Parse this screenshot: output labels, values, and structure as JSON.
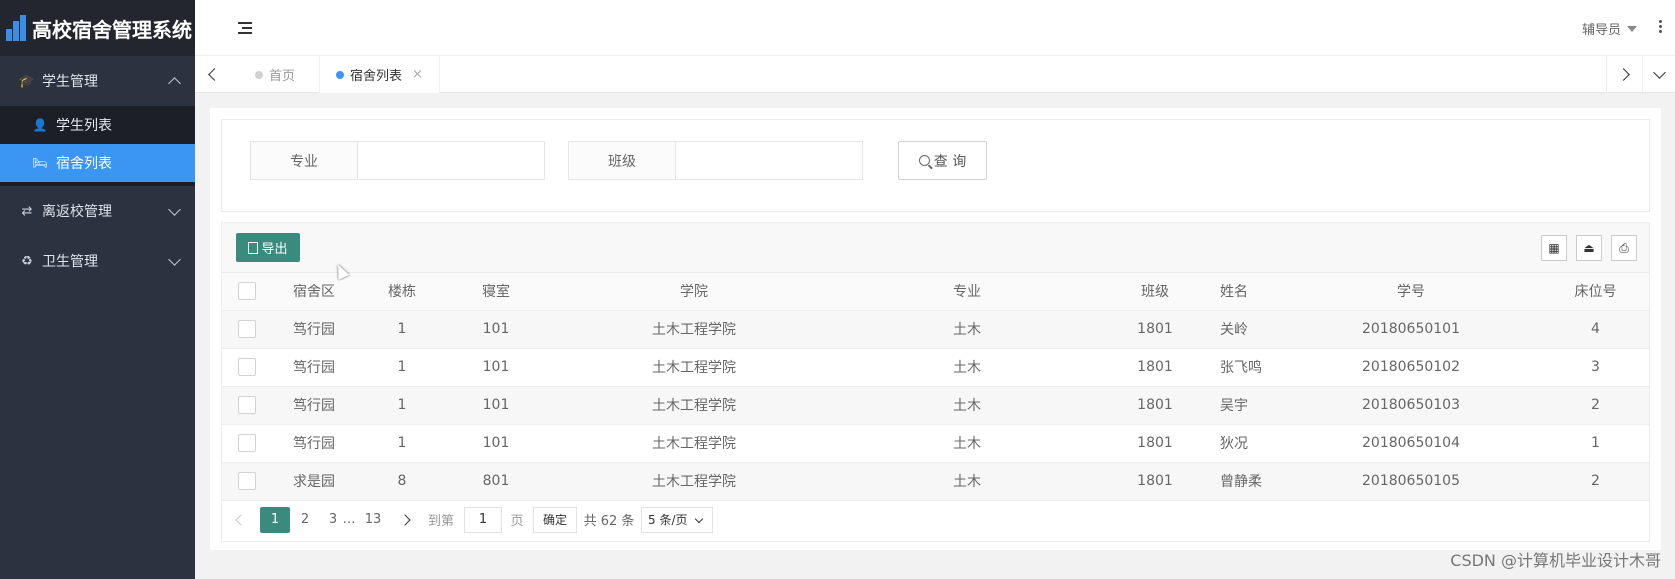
{
  "app": {
    "title": "高校宿舍管理系统"
  },
  "sidebar": {
    "groups": [
      {
        "label": "学生管理",
        "icon": "graduation-cap-icon",
        "expanded": true,
        "items": [
          {
            "label": "学生列表",
            "icon": "user-icon",
            "active": false
          },
          {
            "label": "宿舍列表",
            "icon": "bed-icon",
            "active": true
          }
        ]
      },
      {
        "label": "离返校管理",
        "icon": "exchange-icon",
        "expanded": false
      },
      {
        "label": "卫生管理",
        "icon": "recycle-icon",
        "expanded": false
      }
    ]
  },
  "header": {
    "user": "辅导员"
  },
  "tabs": [
    {
      "label": "首页",
      "active": false
    },
    {
      "label": "宿舍列表",
      "active": true,
      "close": "×"
    }
  ],
  "search": {
    "fields": [
      {
        "label": "专业",
        "value": ""
      },
      {
        "label": "班级",
        "value": ""
      }
    ],
    "button": "查 询"
  },
  "toolbar": {
    "export": "导出"
  },
  "table": {
    "columns": [
      "宿舍区",
      "楼栋",
      "寝室",
      "学院",
      "专业",
      "班级",
      "姓名",
      "学号",
      "床位号"
    ],
    "rows": [
      [
        "笃行园",
        "1",
        "101",
        "土木工程学院",
        "土木",
        "1801",
        "关岭",
        "20180650101",
        "4"
      ],
      [
        "笃行园",
        "1",
        "101",
        "土木工程学院",
        "土木",
        "1801",
        "张飞鸣",
        "20180650102",
        "3"
      ],
      [
        "笃行园",
        "1",
        "101",
        "土木工程学院",
        "土木",
        "1801",
        "吴宇",
        "20180650103",
        "2"
      ],
      [
        "笃行园",
        "1",
        "101",
        "土木工程学院",
        "土木",
        "1801",
        "狄况",
        "20180650104",
        "1"
      ],
      [
        "求是园",
        "8",
        "801",
        "土木工程学院",
        "土木",
        "1801",
        "曾静柔",
        "20180650105",
        "2"
      ]
    ]
  },
  "pagination": {
    "pages": [
      "1",
      "2",
      "3"
    ],
    "ellipsis": "…",
    "last": "13",
    "current": "1",
    "goto_label": "到第",
    "goto_value": "1",
    "page_unit": "页",
    "confirm": "确定",
    "total": "共 62 条",
    "page_size": "5 条/页"
  },
  "watermark": "CSDN @计算机毕业设计木哥"
}
